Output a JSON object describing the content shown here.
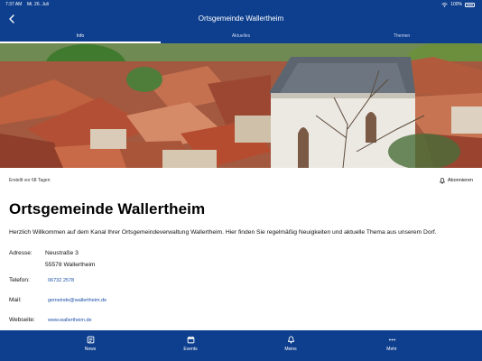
{
  "status": {
    "time": "7:37 AM",
    "date": "Mi. 26. Juli",
    "battery": "100%"
  },
  "header": {
    "title": "Ortsgemeinde Wallertheim"
  },
  "tabs": [
    {
      "label": "Info"
    },
    {
      "label": "Aktuelles"
    },
    {
      "label": "Themen"
    }
  ],
  "info": {
    "created": "Erstellt vor 68 Tagen",
    "subscribe": "Abonnieren",
    "heading": "Ortsgemeinde Wallertheim",
    "intro": "Herzlich Willkommen auf dem Kanal Ihrer Ortsgemeindeverwaltung Wallertheim. Hier finden Sie regelmäßig Neuigkeiten und aktuelle Thema aus unserem Dorf.",
    "address_label": "Adresse:",
    "address_line1": "Neustraße 3",
    "address_line2": "55578 Wallertheim",
    "phone_label": "Telefon:",
    "phone": "06732 2578",
    "mail_label": "Mail:",
    "mail": "gemeinde@wallertheim.de",
    "web_label": "Webseite:",
    "web": "www.wallertheim.de"
  },
  "nav": [
    {
      "label": "News",
      "icon": "news-icon"
    },
    {
      "label": "Events",
      "icon": "calendar-icon"
    },
    {
      "label": "Meins",
      "icon": "bell-icon"
    },
    {
      "label": "Mehr",
      "icon": "more-icon"
    }
  ],
  "colors": {
    "brand": "#0e3f8e",
    "link": "#1b4fa8"
  }
}
